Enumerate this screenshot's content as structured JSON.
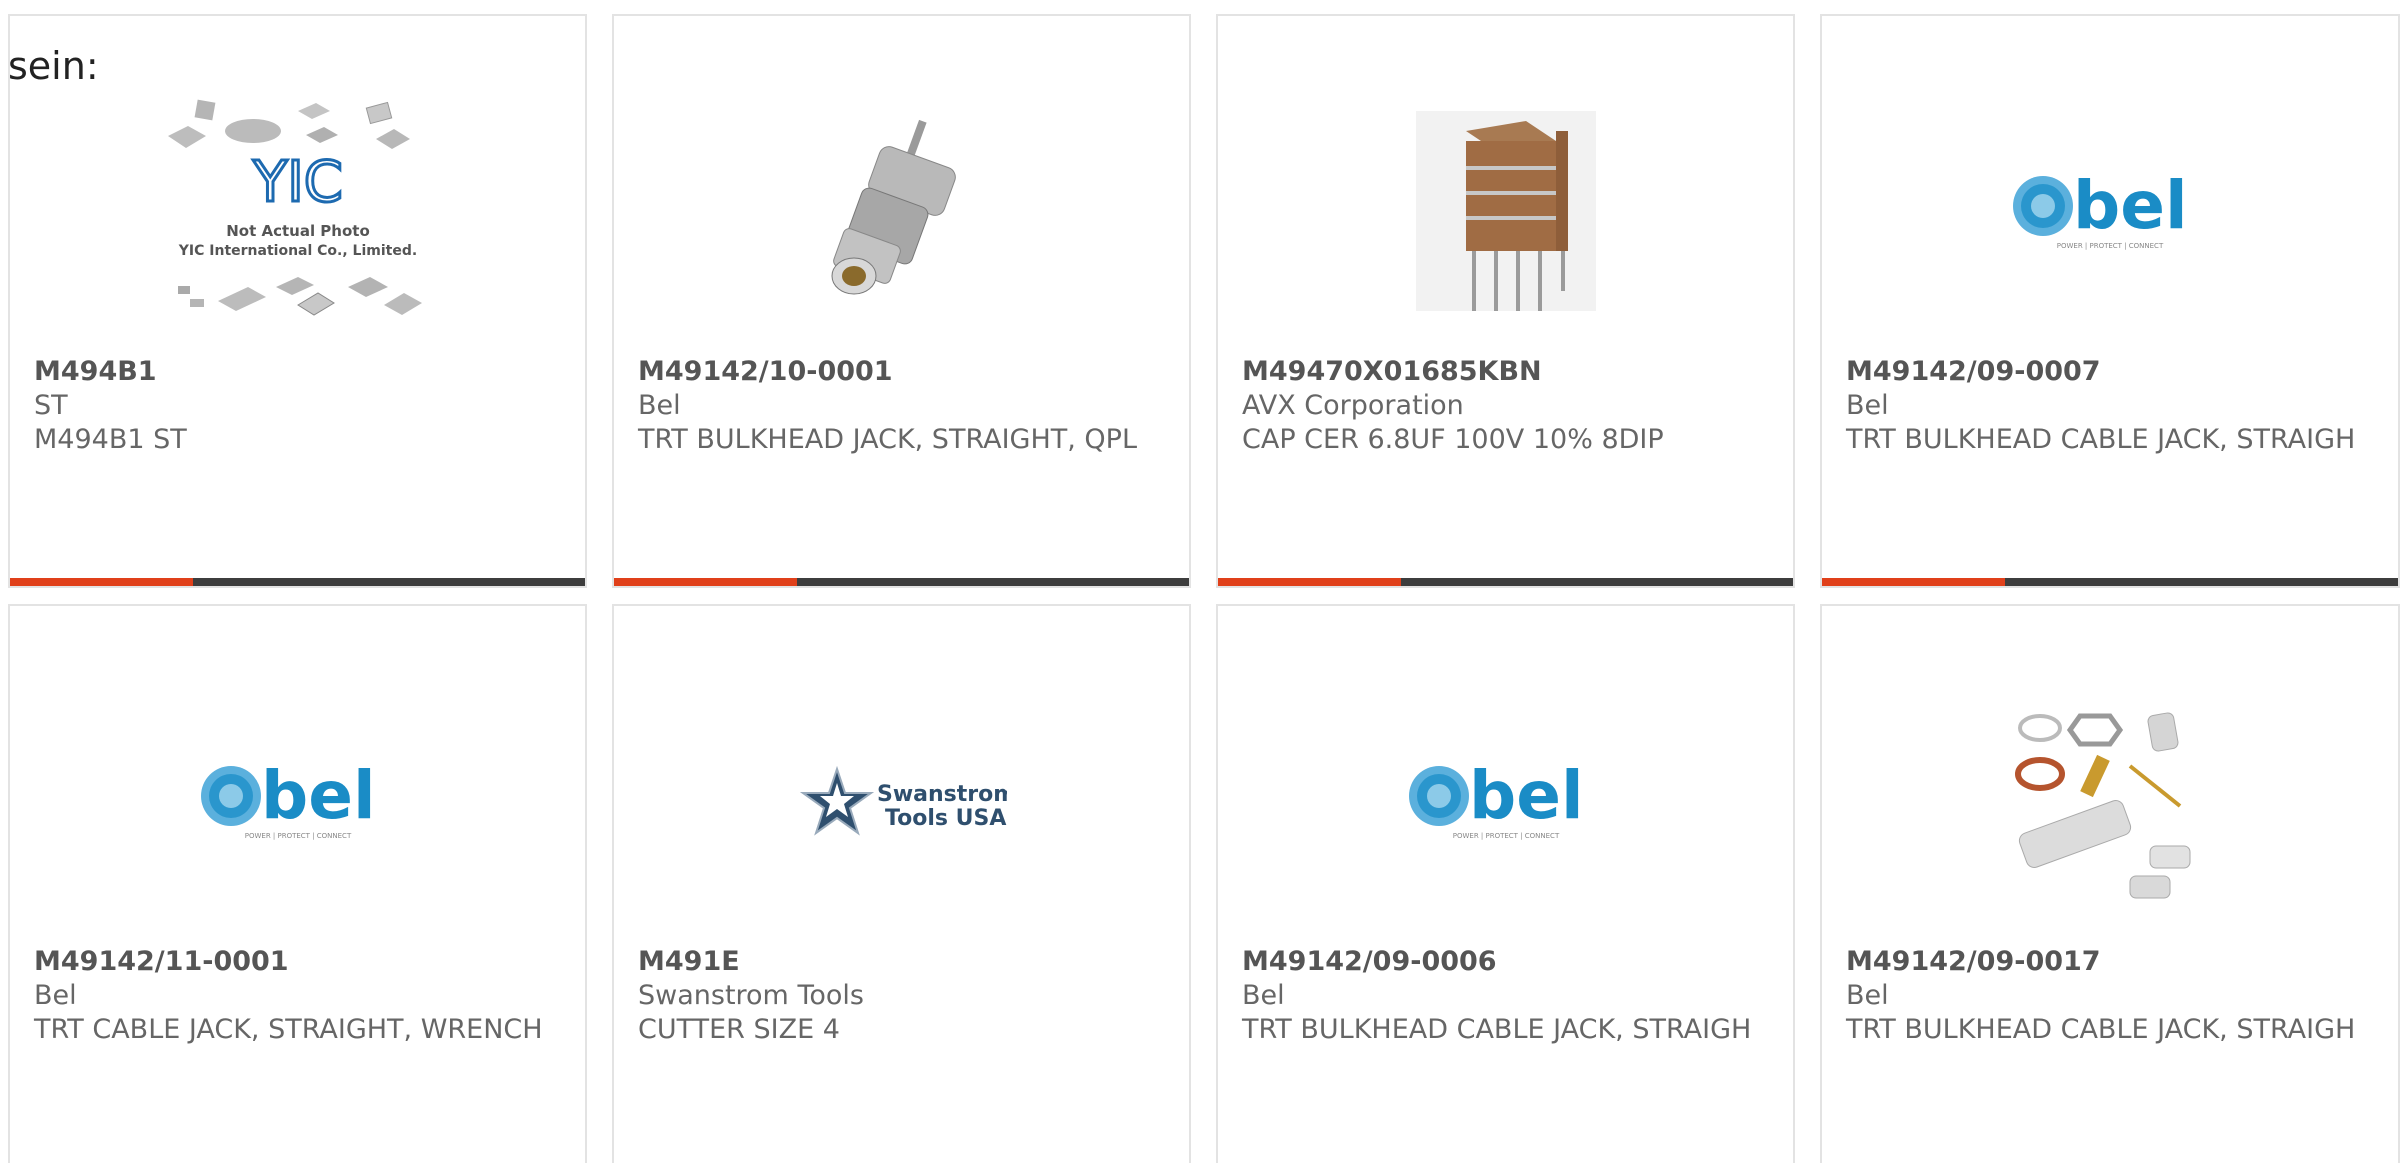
{
  "header": {
    "text": "sein:"
  },
  "colors": {
    "accent": "#e0401a",
    "bar": "#3d3d3d",
    "bel_blue": "#1a8cc6",
    "text": "#666666"
  },
  "cards": [
    {
      "part_number": "M494B1",
      "manufacturer": "ST",
      "description": "M494B1 ST",
      "image": "not-actual-photo-icon",
      "image_text_1": "Not Actual Photo",
      "image_text_2": "YIC International Co., Limited.",
      "image_logo": "YIC"
    },
    {
      "part_number": "M49142/10-0001",
      "manufacturer": "Bel",
      "description": "TRT BULKHEAD JACK, STRAIGHT, QPL",
      "image": "connector-photo"
    },
    {
      "part_number": "M49470X01685KBN",
      "manufacturer": "AVX Corporation",
      "description": "CAP CER 6.8UF 100V 10% 8DIP",
      "image": "capacitor-photo"
    },
    {
      "part_number": "M49142/09-0007",
      "manufacturer": "Bel",
      "description": "TRT BULKHEAD CABLE JACK, STRAIGH",
      "image": "bel-logo",
      "logo_text": "bel",
      "logo_tagline": "POWER | PROTECT | CONNECT"
    },
    {
      "part_number": "M49142/11-0001",
      "manufacturer": "Bel",
      "description": "TRT CABLE JACK, STRAIGHT, WRENCH",
      "image": "bel-logo",
      "logo_text": "bel",
      "logo_tagline": "POWER | PROTECT | CONNECT"
    },
    {
      "part_number": "M491E",
      "manufacturer": "Swanstrom Tools",
      "description": "CUTTER SIZE 4",
      "image": "swanstrom-logo",
      "logo_line1": "Swanstrom",
      "logo_line2": "Tools USA"
    },
    {
      "part_number": "M49142/09-0006",
      "manufacturer": "Bel",
      "description": "TRT BULKHEAD CABLE JACK, STRAIGH",
      "image": "bel-logo",
      "logo_text": "bel",
      "logo_tagline": "POWER | PROTECT | CONNECT"
    },
    {
      "part_number": "M49142/09-0017",
      "manufacturer": "Bel",
      "description": "TRT BULKHEAD CABLE JACK, STRAIGH",
      "image": "connector-kit-photo"
    }
  ]
}
